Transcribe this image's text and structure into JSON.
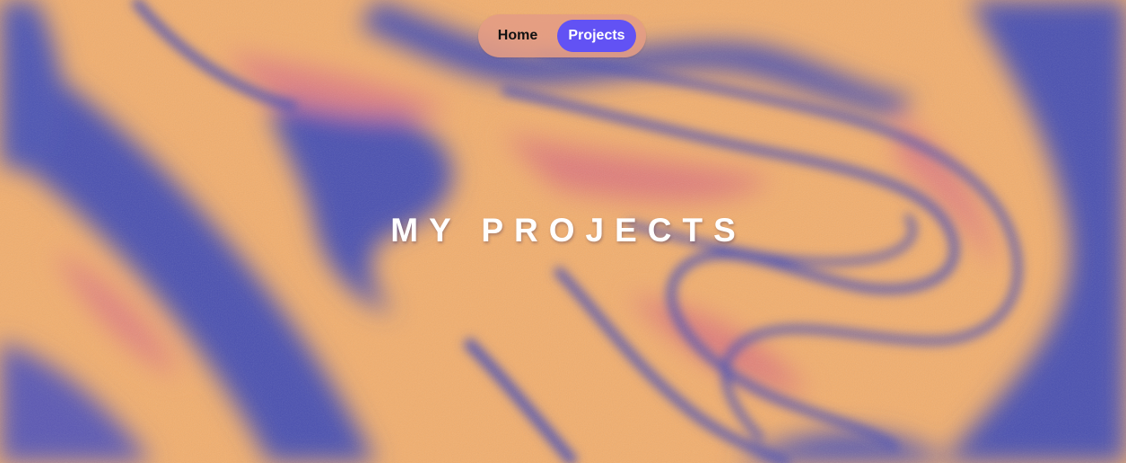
{
  "nav": {
    "items": [
      {
        "label": "Home",
        "active": false
      },
      {
        "label": "Projects",
        "active": true
      }
    ]
  },
  "hero": {
    "title": "MY PROJECTS"
  },
  "colors": {
    "background_blue": "#4a4fb0",
    "background_orange": "#f2ae6d",
    "background_pink": "#df7b7a",
    "accent": "#6252f4",
    "nav_pill": "#e49c84"
  }
}
